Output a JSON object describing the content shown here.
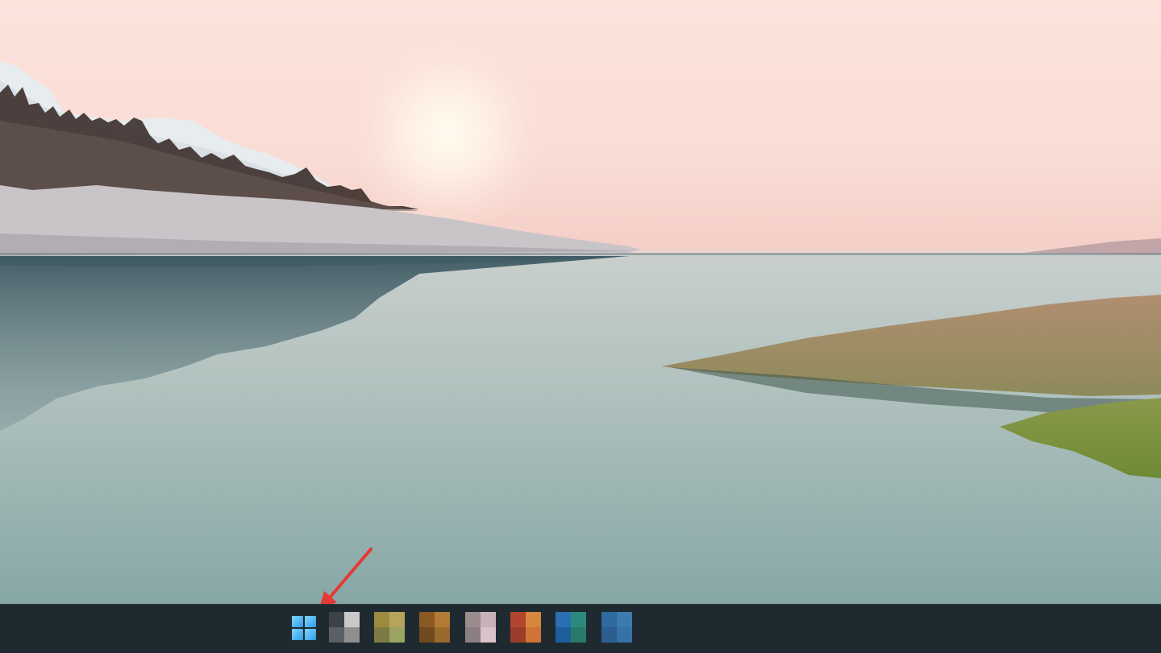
{
  "desktop": {
    "wallpaper": "lake-sunrise-landscape"
  },
  "taskbar": {
    "start_icon": "windows-start-icon",
    "apps": [
      {
        "name": "pinned-app-1",
        "colors": [
          "#3c4248",
          "#c9c9c9",
          "#5b6066",
          "#8f8f8f"
        ]
      },
      {
        "name": "pinned-app-2",
        "colors": [
          "#9c8a3e",
          "#b7a35a",
          "#7e7a44",
          "#9aa460"
        ]
      },
      {
        "name": "pinned-app-3",
        "colors": [
          "#8a5a22",
          "#b27a34",
          "#6e4a1e",
          "#9a6a2c"
        ]
      },
      {
        "name": "pinned-app-4",
        "colors": [
          "#9b8c8e",
          "#c8b2b8",
          "#8b7f84",
          "#d9c3c8"
        ]
      },
      {
        "name": "pinned-app-5",
        "colors": [
          "#b3452f",
          "#d8853d",
          "#9c3d2b",
          "#cf7436"
        ]
      },
      {
        "name": "pinned-app-6",
        "colors": [
          "#2a6fb3",
          "#2b8a7c",
          "#1d5e9b",
          "#2a7a6b"
        ]
      },
      {
        "name": "pinned-app-7",
        "colors": [
          "#2f6aa0",
          "#3b7bb0",
          "#2c5f90",
          "#3672a6"
        ]
      }
    ]
  },
  "annotation": {
    "arrow_color": "#e53935",
    "points_to": "windows-start-icon"
  }
}
